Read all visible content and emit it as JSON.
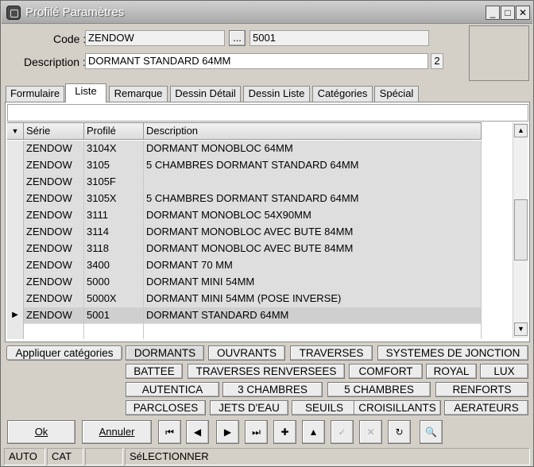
{
  "window": {
    "title": "Profilé Paramètres",
    "min": "_",
    "max": "□",
    "close": "✕"
  },
  "form": {
    "code_label": "Code :",
    "code_value": "ZENDOW",
    "browse_label": "...",
    "code_number": "5001",
    "description_label": "Description :",
    "description_value": "DORMANT STANDARD 64MM",
    "description_badge": "2"
  },
  "tabs": [
    "Formulaire",
    "Liste",
    "Remarque",
    "Dessin Détail",
    "Dessin Liste",
    "Catégories",
    "Spécial"
  ],
  "active_tab": "Liste",
  "grid": {
    "sort_icon": "▼",
    "columns": [
      "Série",
      "Profilé",
      "Description"
    ],
    "rows": [
      [
        "ZENDOW",
        "3104X",
        "DORMANT MONOBLOC 64MM"
      ],
      [
        "ZENDOW",
        "3105",
        "5 CHAMBRES DORMANT STANDARD 64MM"
      ],
      [
        "ZENDOW",
        "3105F",
        ""
      ],
      [
        "ZENDOW",
        "3105X",
        "5 CHAMBRES DORMANT STANDARD 64MM"
      ],
      [
        "ZENDOW",
        "3111",
        "DORMANT MONOBLOC 54X90MM"
      ],
      [
        "ZENDOW",
        "3114",
        "DORMANT MONOBLOC AVEC BUTE 84MM"
      ],
      [
        "ZENDOW",
        "3118",
        "DORMANT MONOBLOC AVEC BUTE 84MM"
      ],
      [
        "ZENDOW",
        "3400",
        "DORMANT 70 MM"
      ],
      [
        "ZENDOW",
        "5000",
        "DORMANT MINI 54MM"
      ],
      [
        "ZENDOW",
        "5000X",
        "DORMANT MINI 54MM (POSE INVERSE)"
      ],
      [
        "ZENDOW",
        "5001",
        "DORMANT STANDARD 64MM"
      ]
    ],
    "current_row_marker": "▶"
  },
  "categories": {
    "apply_label": "Appliquer catégories",
    "row1": [
      "DORMANTS",
      "OUVRANTS",
      "TRAVERSES",
      "SYSTEMES DE JONCTION"
    ],
    "row2": [
      "BATTEE",
      "TRAVERSES RENVERSEES",
      "COMFORT",
      "ROYAL",
      "LUX"
    ],
    "row3": [
      "AUTENTICA",
      "3 CHAMBRES",
      "5 CHAMBRES",
      "RENFORTS"
    ],
    "row4": [
      "PARCLOSES",
      "JETS D'EAU",
      "SEUILS",
      "CROISILLANTS",
      "AERATEURS"
    ]
  },
  "actions": {
    "ok_label": "Ok",
    "cancel_label": "Annuler",
    "nav": [
      {
        "name": "first-record-icon",
        "glyph": "⏮"
      },
      {
        "name": "previous-record-icon",
        "glyph": "◀"
      },
      {
        "name": "next-record-icon",
        "glyph": "▶"
      },
      {
        "name": "last-record-icon",
        "glyph": "⏭"
      },
      {
        "name": "add-record-icon",
        "glyph": "✚"
      },
      {
        "name": "move-up-icon",
        "glyph": "▲"
      },
      {
        "name": "confirm-icon",
        "glyph": "✓"
      },
      {
        "name": "delete-icon",
        "glyph": "✕"
      },
      {
        "name": "refresh-icon",
        "glyph": "↻"
      },
      {
        "name": "binoculars-search-icon",
        "glyph": "🔍"
      }
    ]
  },
  "statusbar": [
    "AUTO",
    "CAT",
    "",
    "SéLECTIONNER"
  ]
}
